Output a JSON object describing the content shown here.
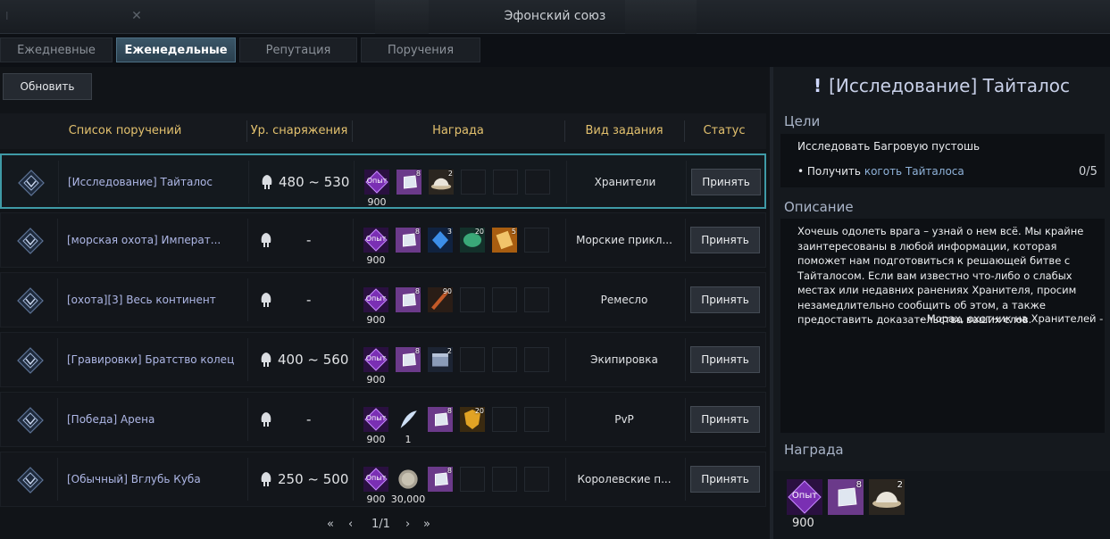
{
  "window": {
    "title": "Эфонский союз"
  },
  "tabs": [
    {
      "label": "Ежедневные",
      "active": false
    },
    {
      "label": "Еженедельные",
      "active": true
    },
    {
      "label": "Репутация",
      "active": false
    },
    {
      "label": "Поручения",
      "active": false
    }
  ],
  "refresh_label": "Обновить",
  "table": {
    "columns": [
      "Список поручений",
      "Ур. снаряжения",
      "Награда",
      "Вид задания",
      "Статус"
    ],
    "rows": [
      {
        "name": "[Исследование] Тайталос",
        "gear": "480 ~ 530",
        "type": "Хранители",
        "status": "Принять",
        "selected": true,
        "rewards": [
          {
            "icon": "exp-icon",
            "label": "Опыт",
            "qty": "900",
            "color": "#7a2fb3"
          },
          {
            "icon": "crystal-icon",
            "count": "8",
            "color": "#6b3a8a"
          },
          {
            "icon": "dish-icon",
            "count": "2",
            "color": "#7a6d5a"
          }
        ]
      },
      {
        "name": "[морская охота] Императ...",
        "gear": "-",
        "type": "Морские прикл...",
        "status": "Принять",
        "rewards": [
          {
            "icon": "exp-icon",
            "label": "Опыт",
            "qty": "900",
            "color": "#7a2fb3"
          },
          {
            "icon": "crystal-icon",
            "count": "8",
            "color": "#6b3a8a"
          },
          {
            "icon": "blue-gem-icon",
            "count": "3",
            "color": "#1d4a8a"
          },
          {
            "icon": "green-gem-icon",
            "count": "20",
            "color": "#1f5d4a"
          },
          {
            "icon": "scroll-icon",
            "count": "5",
            "color": "#b86a14"
          }
        ]
      },
      {
        "name": "[охота][3] Весь континент",
        "gear": "-",
        "type": "Ремесло",
        "status": "Принять",
        "rewards": [
          {
            "icon": "exp-icon",
            "label": "Опыт",
            "qty": "900",
            "color": "#7a2fb3"
          },
          {
            "icon": "crystal-icon",
            "count": "8",
            "color": "#6b3a8a"
          },
          {
            "icon": "feather-brush-icon",
            "count": "90",
            "color": "#5a3a26"
          }
        ]
      },
      {
        "name": "[Гравировки] Братство колец",
        "gear": "400 ~ 560",
        "type": "Экипировка",
        "status": "Принять",
        "rewards": [
          {
            "icon": "exp-icon",
            "label": "Опыт",
            "qty": "900",
            "color": "#7a2fb3"
          },
          {
            "icon": "crystal-icon",
            "count": "8",
            "color": "#6b3a8a"
          },
          {
            "icon": "chest-icon",
            "count": "2",
            "color": "#3a4a66"
          }
        ]
      },
      {
        "name": "[Победа] Арена",
        "gear": "-",
        "type": "PvP",
        "status": "Принять",
        "rewards": [
          {
            "icon": "exp-icon",
            "label": "Опыт",
            "qty": "900",
            "color": "#7a2fb3"
          },
          {
            "icon": "feather-icon",
            "qty": "1",
            "color": "#1a1e24"
          },
          {
            "icon": "crystal-icon",
            "count": "8",
            "color": "#6b3a8a"
          },
          {
            "icon": "shield-icon",
            "count": "20",
            "color": "#8a5a10"
          }
        ]
      },
      {
        "name": "[Обычный] Вглубь Куба",
        "gear": "250 ~ 500",
        "type": "Королевские п...",
        "status": "Принять",
        "rewards": [
          {
            "icon": "exp-icon",
            "label": "Опыт",
            "qty": "900",
            "color": "#7a2fb3"
          },
          {
            "icon": "coin-icon",
            "qty": "30,000",
            "color": "#1a1e24"
          },
          {
            "icon": "crystal-icon",
            "count": "8",
            "color": "#6b3a8a"
          }
        ]
      }
    ]
  },
  "pager": {
    "first": "«",
    "prev": "‹",
    "text": "1/1",
    "next": "›",
    "last": "»"
  },
  "detail": {
    "title": "[Исследование] Тайталос",
    "goals_heading": "Цели",
    "goal_main": "Исследовать Багровую пустошь",
    "goal_sub_prefix": "Получить",
    "goal_sub_item": "коготь Тайталоса",
    "goal_count": "0/5",
    "description_heading": "Описание",
    "description": "Хочешь одолеть врага – узнай о нем всё. Мы крайне заинтересованы в любой информации, которая поможет нам подготовиться к решающей битве с Тайталосом. Если вам известно что-либо о слабых местах или недавних ранениях Хранителя, просим незамедлительно сообщить об этом, а также предоставить доказательства ваших слов.",
    "signature": "- Морах, охотник на Хранителей -",
    "reward_heading": "Награда",
    "rewards": [
      {
        "icon": "exp-icon",
        "label": "Опыт",
        "qty": "900",
        "color": "#7a2fb3"
      },
      {
        "icon": "crystal-icon",
        "count": "8",
        "color": "#6b3a8a"
      },
      {
        "icon": "dish-icon",
        "count": "2",
        "color": "#7a6d5a"
      }
    ]
  }
}
